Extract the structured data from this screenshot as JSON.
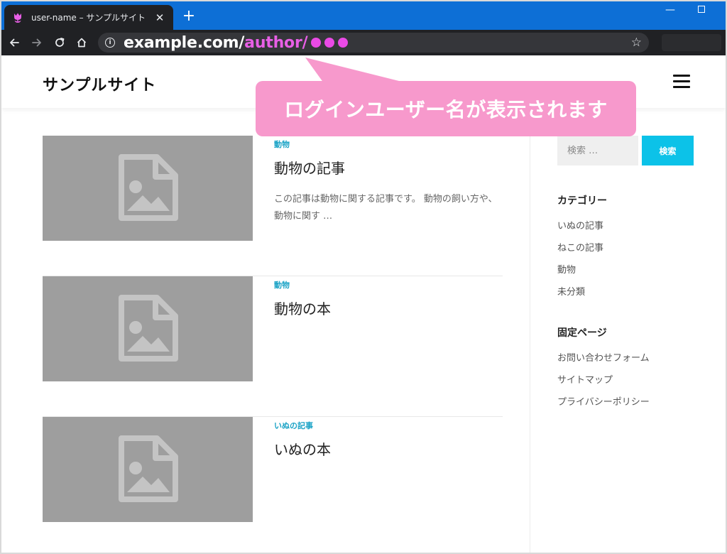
{
  "browser": {
    "tab_title": "user-name – サンプルサイト",
    "tab_close": "✕",
    "new_tab": "+",
    "url_host": "example.com/",
    "url_path": "author/"
  },
  "site": {
    "title": "サンプルサイト"
  },
  "callout": {
    "text": "ログインユーザー名が表示されます",
    "color": "#f799cc"
  },
  "posts": [
    {
      "category": "動物",
      "title": "動物の記事",
      "excerpt": "この記事は動物に関する記事です。 動物の飼い方や、動物に関す …"
    },
    {
      "category": "動物",
      "title": "動物の本",
      "excerpt": ""
    },
    {
      "category": "いぬの記事",
      "title": "いぬの本",
      "excerpt": ""
    }
  ],
  "sidebar": {
    "search_placeholder": "検索 …",
    "search_button": "検索",
    "categories_heading": "カテゴリー",
    "categories": [
      "いぬの記事",
      "ねこの記事",
      "動物",
      "未分類"
    ],
    "pages_heading": "固定ページ",
    "pages": [
      "お問い合わせフォーム",
      "サイトマップ",
      "プライバシーポリシー"
    ]
  },
  "colors": {
    "tabbar": "#0d6fd6",
    "browser_dark": "#202124",
    "url_highlight": "#e85fe6",
    "category_link": "#1ba3c6",
    "search_button": "#0cc2e8",
    "thumbnail": "#9e9e9e"
  },
  "icons": {
    "favicon": "tulip-icon",
    "back": "arrow-left-icon",
    "forward": "arrow-right-icon",
    "reload": "reload-icon",
    "home": "home-icon",
    "site_info": "info-icon",
    "bookmark": "star-icon",
    "menu": "hamburger-icon",
    "thumbnail": "image-file-icon"
  }
}
